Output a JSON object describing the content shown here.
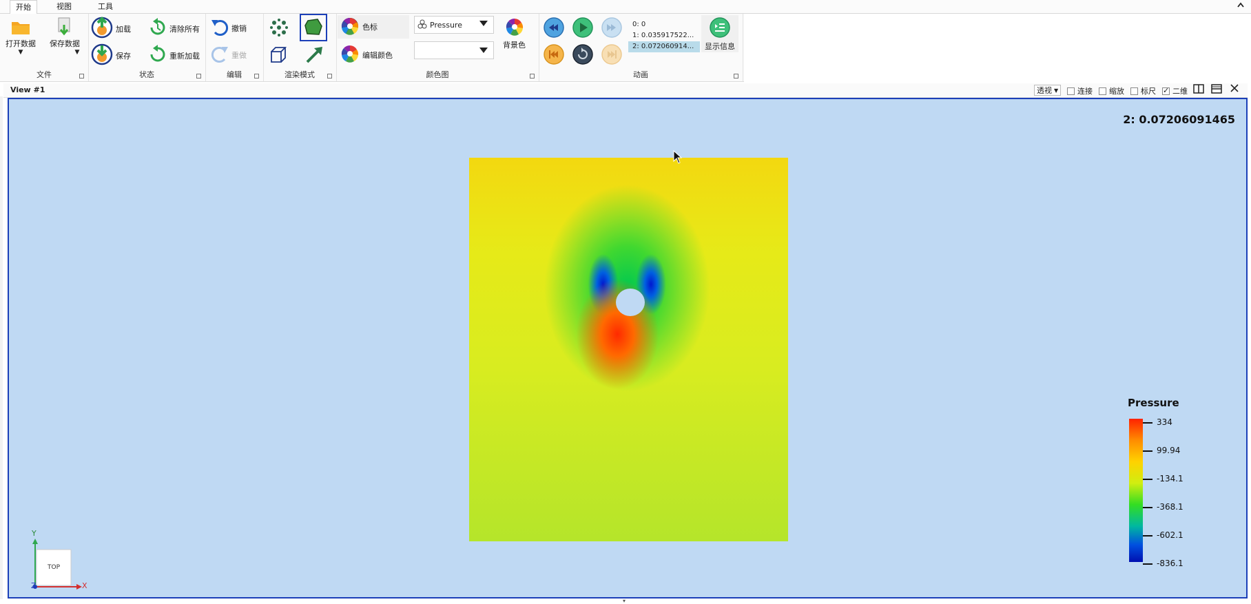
{
  "tabs": [
    {
      "label": "开始",
      "active": true
    },
    {
      "label": "视图",
      "active": false
    },
    {
      "label": "工具",
      "active": false
    }
  ],
  "ribbon": {
    "file": {
      "group_label": "文件",
      "open_label": "打开数据",
      "save_data_label": "保存数据"
    },
    "state": {
      "group_label": "状态",
      "load_label": "加载",
      "save_label": "保存",
      "clear_all_label": "清除所有",
      "reload_label": "重新加载"
    },
    "edit": {
      "group_label": "编辑",
      "undo_label": "撤销",
      "redo_label": "重做"
    },
    "render": {
      "group_label": "渲染模式"
    },
    "colormap": {
      "group_label": "颜色图",
      "color_legend_label": "色标",
      "edit_color_label": "编辑颜色",
      "array_value": "Pressure",
      "component_value": "",
      "background_label": "背景色"
    },
    "animation": {
      "group_label": "动画",
      "timesteps": [
        "0: 0",
        "1: 0.035917522...",
        "2: 0.072060914..."
      ],
      "selected_index": 2,
      "show_info_label": "显示信息"
    }
  },
  "view": {
    "title": "View #1",
    "projection_value": "透视",
    "options": [
      {
        "label": "连接",
        "checked": false
      },
      {
        "label": "缩放",
        "checked": false
      },
      {
        "label": "标尺",
        "checked": false
      },
      {
        "label": "二维",
        "checked": true
      }
    ],
    "timestamp": "2: 0.07206091465",
    "legend": {
      "title": "Pressure",
      "ticks": [
        "334",
        "99.94",
        "-134.1",
        "-368.1",
        "-602.1",
        "-836.1"
      ]
    },
    "axes": {
      "x": "X",
      "y": "Y",
      "z": "Z",
      "cube_label": "TOP"
    }
  },
  "colors": {
    "accent": "#1b3fb8",
    "viewport_bg": "#bfd9f3"
  }
}
